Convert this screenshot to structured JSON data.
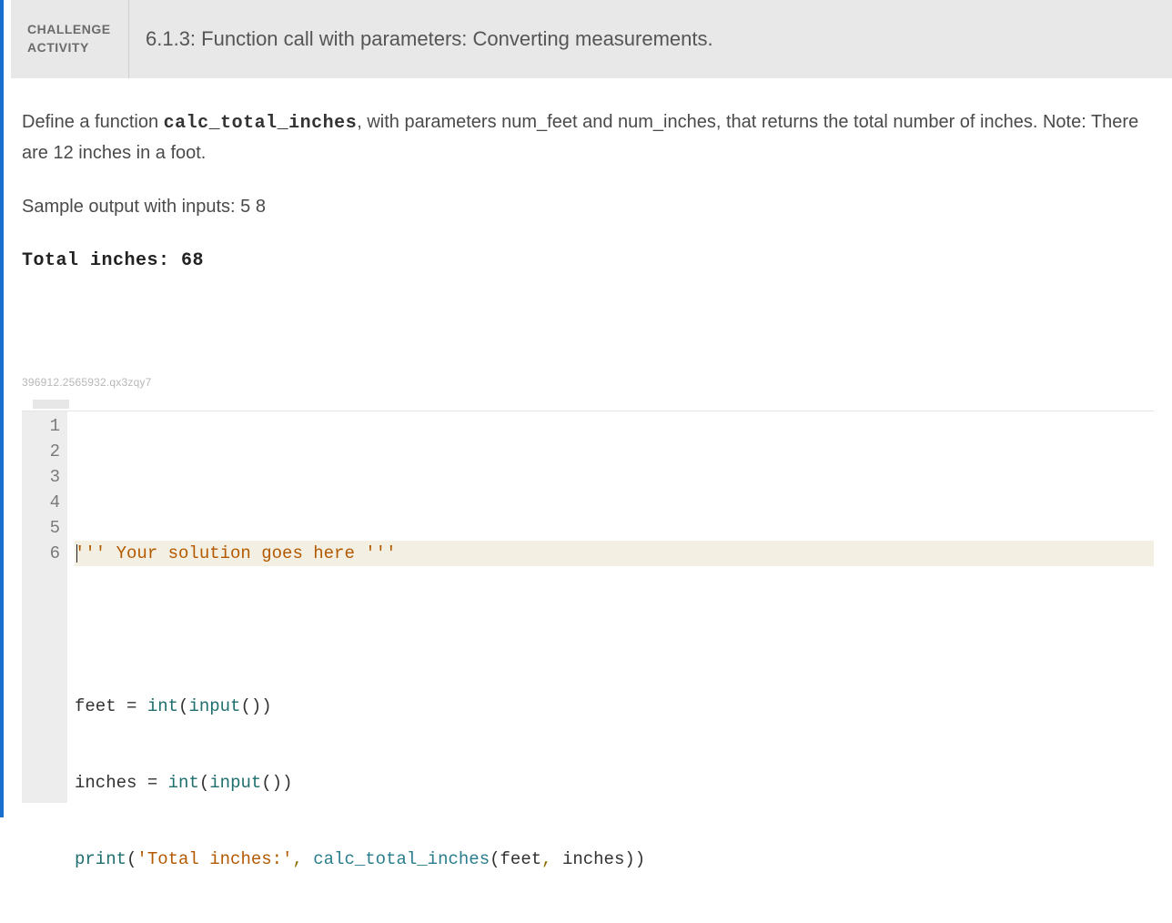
{
  "header": {
    "tag_line1": "CHALLENGE",
    "tag_line2": "ACTIVITY",
    "title": "6.1.3: Function call with parameters: Converting measurements."
  },
  "description": {
    "pre_text": "Define a function ",
    "code_name": "calc_total_inches",
    "post_text": ", with parameters num_feet and num_inches, that returns the total number of inches. Note: There are 12 inches in a foot.",
    "sample_label": "Sample output with inputs: 5 8",
    "sample_output": "Total inches: 68"
  },
  "instance_id": "396912.2565932.qx3zqy7",
  "editor": {
    "line_numbers": [
      "1",
      "2",
      "3",
      "4",
      "5",
      "6"
    ],
    "line2": {
      "str_open": "''' ",
      "text": "Your solution goes here ",
      "str_close": "'''"
    },
    "line4": {
      "id": "feet",
      "eq": " = ",
      "fn1": "int",
      "lp1": "(",
      "fn2": "input",
      "pp": "())"
    },
    "line5": {
      "id": "inches",
      "eq": " = ",
      "fn1": "int",
      "lp1": "(",
      "fn2": "input",
      "pp": "())"
    },
    "line6": {
      "fn": "print",
      "lp": "(",
      "str": "'Total inches:'",
      "comma": ", ",
      "call": "calc_total_inches",
      "lp2": "(",
      "arg1": "feet",
      "c2": ", ",
      "arg2": "inches",
      "rp": "))"
    }
  }
}
